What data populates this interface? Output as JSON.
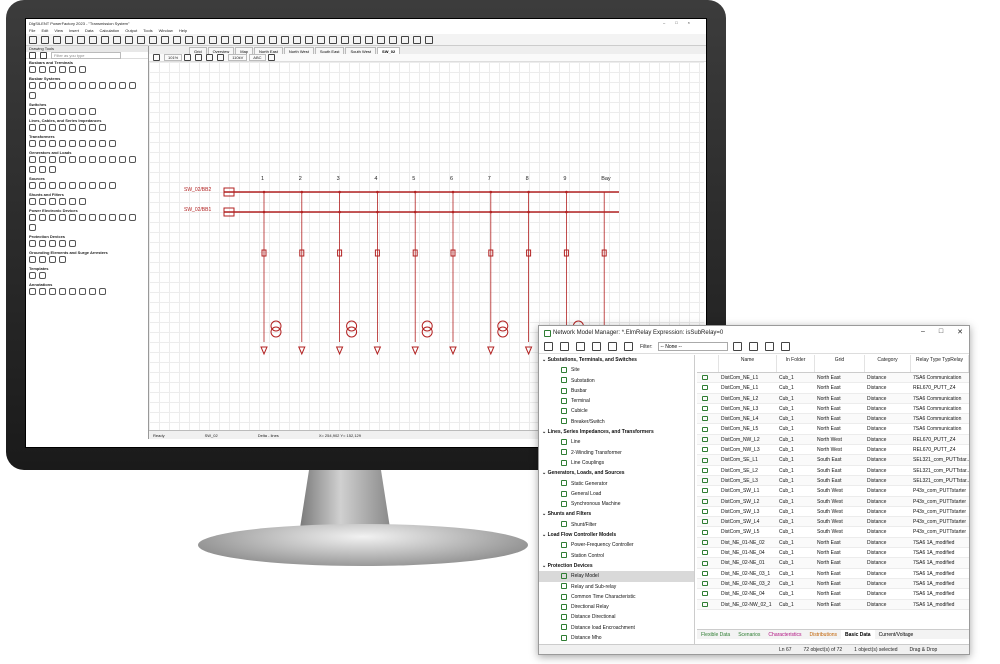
{
  "pf": {
    "title": "DIgSILENT PowerFactory 2023 - \"Transmission System\"",
    "menu": [
      "File",
      "Edit",
      "View",
      "Insert",
      "Data",
      "Calculation",
      "Output",
      "Tools",
      "Window",
      "Help"
    ],
    "left_panel_title": "Drawing Tools",
    "filter_placeholder": "Filter as you type",
    "side_tabs": [
      "Project Overview",
      "Drawing Tools"
    ],
    "sections": [
      "Busbars and Terminals",
      "Busbar Systems",
      "Switches",
      "Lines, Cables, and Series Impedances",
      "Transformers",
      "Generators and Loads",
      "Sources",
      "Shunts and Filters",
      "Power Electronic Devices",
      "Protection Devices",
      "Grounding Elements and Surge Arresters",
      "Templates",
      "Annotations"
    ],
    "tabs": [
      "Grid",
      "Overview",
      "Map",
      "North East",
      "North West",
      "South East",
      "South West",
      "SW_02"
    ],
    "active_tab": "SW_02",
    "zoom": "101%",
    "combo1": "110kV",
    "combo2": "ABC",
    "bays": [
      "1",
      "2",
      "3",
      "4",
      "5",
      "6",
      "7",
      "8",
      "9",
      "Bay"
    ],
    "busbars": [
      "SW_02/BB2",
      "SW_02/BB1"
    ],
    "status": [
      "Ready",
      "SW_02",
      "Delta - lines",
      "X= 254,902 Y= 152,129"
    ]
  },
  "nmm": {
    "title": "Network Model Manager: *.ElmRelay  Expression: isSubRelay=0",
    "filter_label": "Filter:",
    "filter_value": "-- None --",
    "tree": [
      {
        "t": "cat",
        "label": "Substations, Terminals, and Switches"
      },
      {
        "t": "item",
        "label": "Site"
      },
      {
        "t": "item",
        "label": "Substation"
      },
      {
        "t": "item",
        "label": "Busbar"
      },
      {
        "t": "item",
        "label": "Terminal"
      },
      {
        "t": "item",
        "label": "Cubicle"
      },
      {
        "t": "item",
        "label": "Breaker/Switch"
      },
      {
        "t": "cat",
        "label": "Lines, Series Impedances, and Transformers"
      },
      {
        "t": "item",
        "label": "Line"
      },
      {
        "t": "item",
        "label": "2-Winding Transformer"
      },
      {
        "t": "item",
        "label": "Line Couplings"
      },
      {
        "t": "cat",
        "label": "Generators, Loads, and Sources"
      },
      {
        "t": "item",
        "label": "Static Generator"
      },
      {
        "t": "item",
        "label": "General Load"
      },
      {
        "t": "item",
        "label": "Synchronous Machine"
      },
      {
        "t": "cat",
        "label": "Shunts and Filters"
      },
      {
        "t": "item",
        "label": "Shunt/Filter"
      },
      {
        "t": "cat",
        "label": "Load Flow Controller Models"
      },
      {
        "t": "item",
        "label": "Power-Frequency Controller"
      },
      {
        "t": "item",
        "label": "Station Control"
      },
      {
        "t": "cat",
        "label": "Protection Devices"
      },
      {
        "t": "item",
        "label": "Relay Model",
        "sel": true
      },
      {
        "t": "item",
        "label": "Relay and Sub-relay"
      },
      {
        "t": "item",
        "label": "Common Time Characteristic"
      },
      {
        "t": "item",
        "label": "Directional Relay"
      },
      {
        "t": "item",
        "label": "Distance Directional"
      },
      {
        "t": "item",
        "label": "Distance load Encroachment"
      },
      {
        "t": "item",
        "label": "Distance Mho"
      }
    ],
    "columns": [
      "",
      "Name",
      "In Folder",
      "Grid",
      "Category",
      "Relay Type TypRelay"
    ],
    "rows": [
      [
        "DistCom_NE_L1",
        "Cub_1",
        "North East",
        "Distance",
        "7SA6 Communication"
      ],
      [
        "DistCom_NE_L1",
        "Cub_1",
        "North East",
        "Distance",
        "REL670_PUTT_Z4"
      ],
      [
        "DistCom_NE_L2",
        "Cub_1",
        "North East",
        "Distance",
        "7SA6 Communication"
      ],
      [
        "DistCom_NE_L3",
        "Cub_1",
        "North East",
        "Distance",
        "7SA6 Communication"
      ],
      [
        "DistCom_NE_L4",
        "Cub_1",
        "North East",
        "Distance",
        "7SA6 Communication"
      ],
      [
        "DistCom_NE_L5",
        "Cub_1",
        "North East",
        "Distance",
        "7SA6 Communication"
      ],
      [
        "DistCom_NW_L2",
        "Cub_1",
        "North West",
        "Distance",
        "REL670_PUTT_Z4"
      ],
      [
        "DistCom_NW_L3",
        "Cub_1",
        "North West",
        "Distance",
        "REL670_PUTT_Z4"
      ],
      [
        "DistCom_SE_L1",
        "Cub_1",
        "South East",
        "Distance",
        "SEL321_com_PUTTstar..."
      ],
      [
        "DistCom_SE_L2",
        "Cub_1",
        "South East",
        "Distance",
        "SEL321_com_PUTTstar..."
      ],
      [
        "DistCom_SE_L3",
        "Cub_1",
        "South East",
        "Distance",
        "SEL321_com_PUTTstar..."
      ],
      [
        "DistCom_SW_L1",
        "Cub_1",
        "South West",
        "Distance",
        "P43x_com_PUTTstarter"
      ],
      [
        "DistCom_SW_L2",
        "Cub_1",
        "South West",
        "Distance",
        "P43x_com_PUTTstarter"
      ],
      [
        "DistCom_SW_L3",
        "Cub_1",
        "South West",
        "Distance",
        "P43x_com_PUTTstarter"
      ],
      [
        "DistCom_SW_L4",
        "Cub_1",
        "South West",
        "Distance",
        "P43x_com_PUTTstarter"
      ],
      [
        "DistCom_SW_L5",
        "Cub_1",
        "South West",
        "Distance",
        "P43x_com_PUTTstarter"
      ],
      [
        "Dist_NE_01-NE_02",
        "Cub_1",
        "North East",
        "Distance",
        "7SA6 1A_modified"
      ],
      [
        "Dist_NE_01-NE_04",
        "Cub_1",
        "North East",
        "Distance",
        "7SA6 1A_modified"
      ],
      [
        "Dist_NE_02-NE_01",
        "Cub_1",
        "North East",
        "Distance",
        "7SA6 1A_modified"
      ],
      [
        "Dist_NE_02-NE_03_1",
        "Cub_1",
        "North East",
        "Distance",
        "7SA6 1A_modified"
      ],
      [
        "Dist_NE_02-NE_03_2",
        "Cub_1",
        "North East",
        "Distance",
        "7SA6 1A_modified"
      ],
      [
        "Dist_NE_02-NE_04",
        "Cub_1",
        "North East",
        "Distance",
        "7SA6 1A_modified"
      ],
      [
        "Dist_NE_02-NW_02_1",
        "Cub_1",
        "North East",
        "Distance",
        "7SA6 1A_modified"
      ]
    ],
    "tabs": [
      "Flexible Data",
      "Scenarios",
      "Characteristics",
      "Distributions",
      "Basic Data",
      "Current/Voltage"
    ],
    "active_tab": "Basic Data",
    "status": [
      "Ln 67",
      "72 object(s) of 72",
      "1 object(s) selected",
      "Drag & Drop"
    ]
  }
}
